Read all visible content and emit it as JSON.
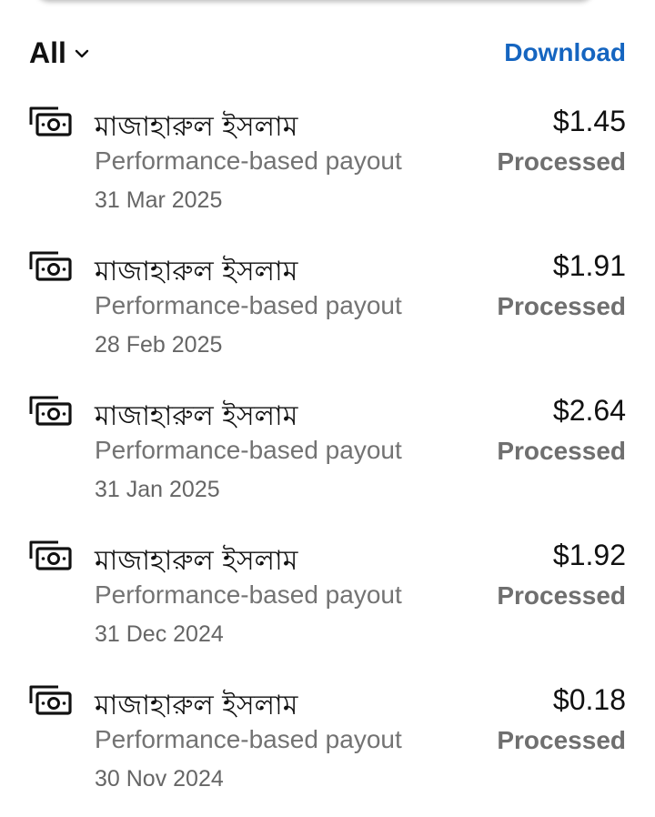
{
  "filter": {
    "label": "All",
    "icon": "chevron-down-icon"
  },
  "toolbar": {
    "download_label": "Download",
    "accent": "#1565c0"
  },
  "payouts": [
    {
      "payee": "মাজাহারুল ইসলাম",
      "type": "Performance-based payout",
      "date": "31 Mar 2025",
      "amount": "$1.45",
      "status": "Processed",
      "icon": "money-bill-icon"
    },
    {
      "payee": "মাজাহারুল ইসলাম",
      "type": "Performance-based payout",
      "date": "28 Feb 2025",
      "amount": "$1.91",
      "status": "Processed",
      "icon": "money-bill-icon"
    },
    {
      "payee": "মাজাহারুল ইসলাম",
      "type": "Performance-based payout",
      "date": "31 Jan 2025",
      "amount": "$2.64",
      "status": "Processed",
      "icon": "money-bill-icon"
    },
    {
      "payee": "মাজাহারুল ইসলাম",
      "type": "Performance-based payout",
      "date": "31 Dec 2024",
      "amount": "$1.92",
      "status": "Processed",
      "icon": "money-bill-icon"
    },
    {
      "payee": "মাজাহারুল ইসলাম",
      "type": "Performance-based payout",
      "date": "30 Nov 2024",
      "amount": "$0.18",
      "status": "Processed",
      "icon": "money-bill-icon"
    }
  ]
}
